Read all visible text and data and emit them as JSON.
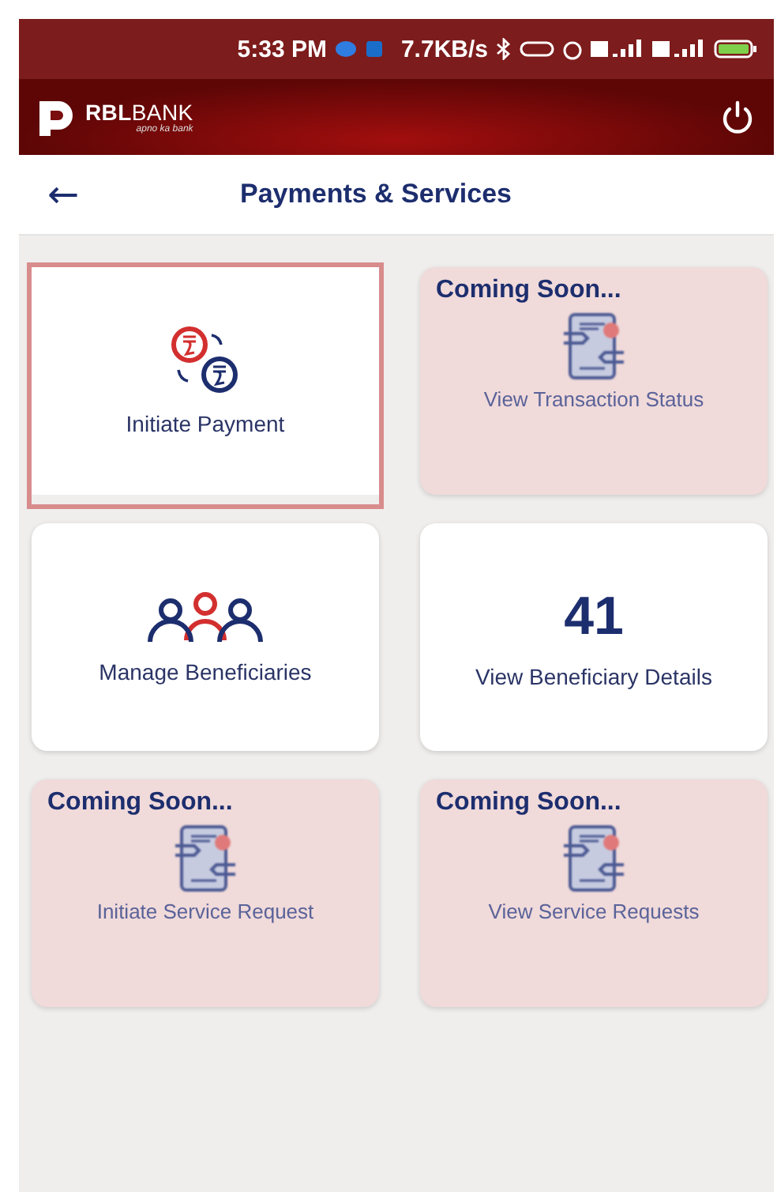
{
  "status_bar": {
    "time": "5:33 PM",
    "speed": "7.7KB/s"
  },
  "header": {
    "brand_bold": "RBL",
    "brand_rest": "BANK",
    "tagline": "apno ka bank"
  },
  "title_bar": {
    "back": "←",
    "title": "Payments & Services"
  },
  "tiles": [
    {
      "kind": "payment",
      "label": "Initiate Payment",
      "highlighted": true
    },
    {
      "kind": "coming_soon",
      "badge": "Coming Soon...",
      "label": "View Transaction Status",
      "highlighted": false
    },
    {
      "kind": "beneficiaries",
      "label": "Manage Beneficiaries",
      "highlighted": false
    },
    {
      "kind": "count",
      "count": "41",
      "label": "View Beneficiary Details",
      "highlighted": false
    },
    {
      "kind": "coming_soon",
      "badge": "Coming Soon...",
      "label": "Initiate Service Request",
      "highlighted": false
    },
    {
      "kind": "coming_soon",
      "badge": "Coming Soon...",
      "label": "View Service Requests",
      "highlighted": false
    }
  ]
}
